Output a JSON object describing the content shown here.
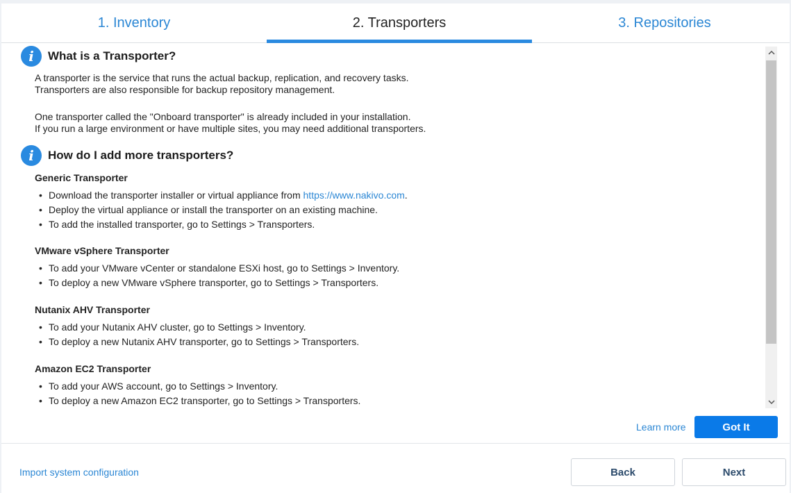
{
  "tabs": [
    {
      "label": "1. Inventory",
      "active": false
    },
    {
      "label": "2. Transporters",
      "active": true
    },
    {
      "label": "3. Repositories",
      "active": false
    }
  ],
  "section1": {
    "title": "What is a Transporter?",
    "lines": [
      "A transporter is the service that runs the actual backup, replication, and recovery tasks.",
      "Transporters are also responsible for backup repository management.",
      "One transporter called the \"Onboard transporter\" is already included in your installation.",
      "If you run a large environment or have multiple sites, you may need additional transporters."
    ]
  },
  "section2": {
    "title": "How do I add more transporters?",
    "groups": [
      {
        "title": "Generic Transporter",
        "bullets": [
          {
            "before": "Download the transporter installer or virtual appliance from ",
            "link": "https://www.nakivo.com",
            "after": "."
          },
          {
            "text": "Deploy the virtual appliance or install the transporter on an existing machine."
          },
          {
            "text": "To add the installed transporter, go to Settings > Transporters."
          }
        ]
      },
      {
        "title": "VMware vSphere Transporter",
        "bullets": [
          {
            "text": "To add your VMware vCenter or standalone ESXi host, go to Settings > Inventory."
          },
          {
            "text": "To deploy a new VMware vSphere transporter, go to Settings > Transporters."
          }
        ]
      },
      {
        "title": "Nutanix AHV Transporter",
        "bullets": [
          {
            "text": "To add your Nutanix AHV cluster, go to Settings > Inventory."
          },
          {
            "text": "To deploy a new Nutanix AHV transporter, go to Settings > Transporters."
          }
        ]
      },
      {
        "title": "Amazon EC2 Transporter",
        "bullets": [
          {
            "text": "To add your AWS account, go to Settings > Inventory."
          },
          {
            "text": "To deploy a new Amazon EC2 transporter, go to Settings > Transporters."
          }
        ]
      }
    ]
  },
  "actions": {
    "learn_more": "Learn more",
    "got_it": "Got It",
    "import": "Import system configuration",
    "back": "Back",
    "next": "Next"
  },
  "icons": {
    "info": "info-icon",
    "scroll_up": "chevron-up-icon",
    "scroll_down": "chevron-down-icon"
  },
  "colors": {
    "accent": "#2a8ae0",
    "primary_button": "#0a7ae8",
    "link": "#2a86d4"
  }
}
